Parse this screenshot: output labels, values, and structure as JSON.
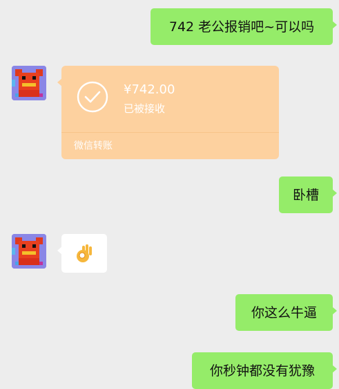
{
  "messages": {
    "m1": {
      "text": "742 老公报销吧~可以吗"
    },
    "transfer": {
      "amount": "¥742.00",
      "status": "已被接收",
      "footer": "微信转账",
      "check_icon": "check-icon"
    },
    "m2": {
      "text": "卧槽"
    },
    "sticker": {
      "icon": "ok-hand-icon"
    },
    "m3": {
      "text": "你这么牛逼"
    },
    "m4": {
      "text": "你秒钟都没有犹豫"
    }
  },
  "colors": {
    "background": "#ededed",
    "self_bubble": "#95ec69",
    "transfer_card": "#fdd19f",
    "other_bubble": "#ffffff"
  }
}
